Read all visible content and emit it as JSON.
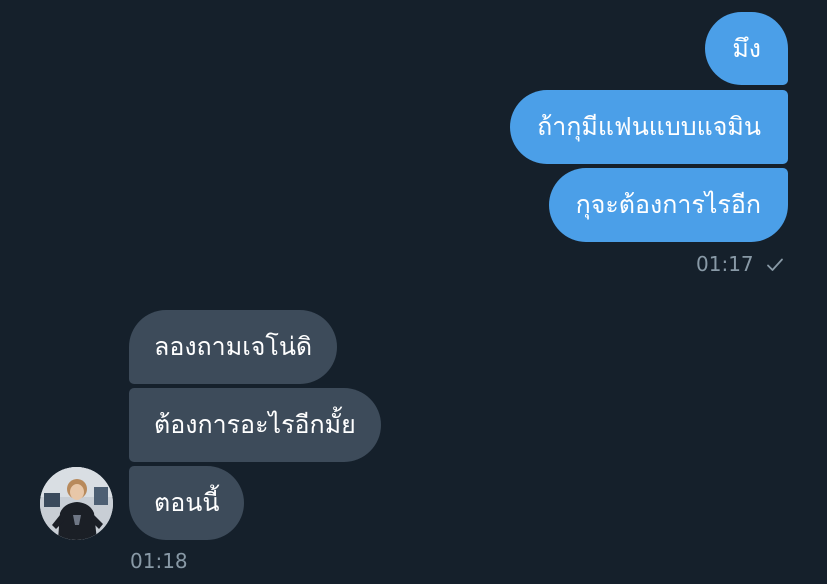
{
  "sent_messages": [
    {
      "text": "มึง"
    },
    {
      "text": "ถ้ากุมีแฟนแบบแจมิน"
    },
    {
      "text": "กุจะต้องการไรอีก"
    }
  ],
  "sent_time": "01:17",
  "sent_status_icon": "check-icon",
  "received_messages": [
    {
      "text": "ลองถามเจโน่ดิ"
    },
    {
      "text": "ต้องการอะไรอีกมั้ย"
    },
    {
      "text": "ตอนนี้"
    }
  ],
  "received_time": "01:18",
  "colors": {
    "background": "#15202b",
    "sent_bubble": "#4b9fe8",
    "received_bubble": "#3d4b5a",
    "meta_text": "#8899a6"
  }
}
